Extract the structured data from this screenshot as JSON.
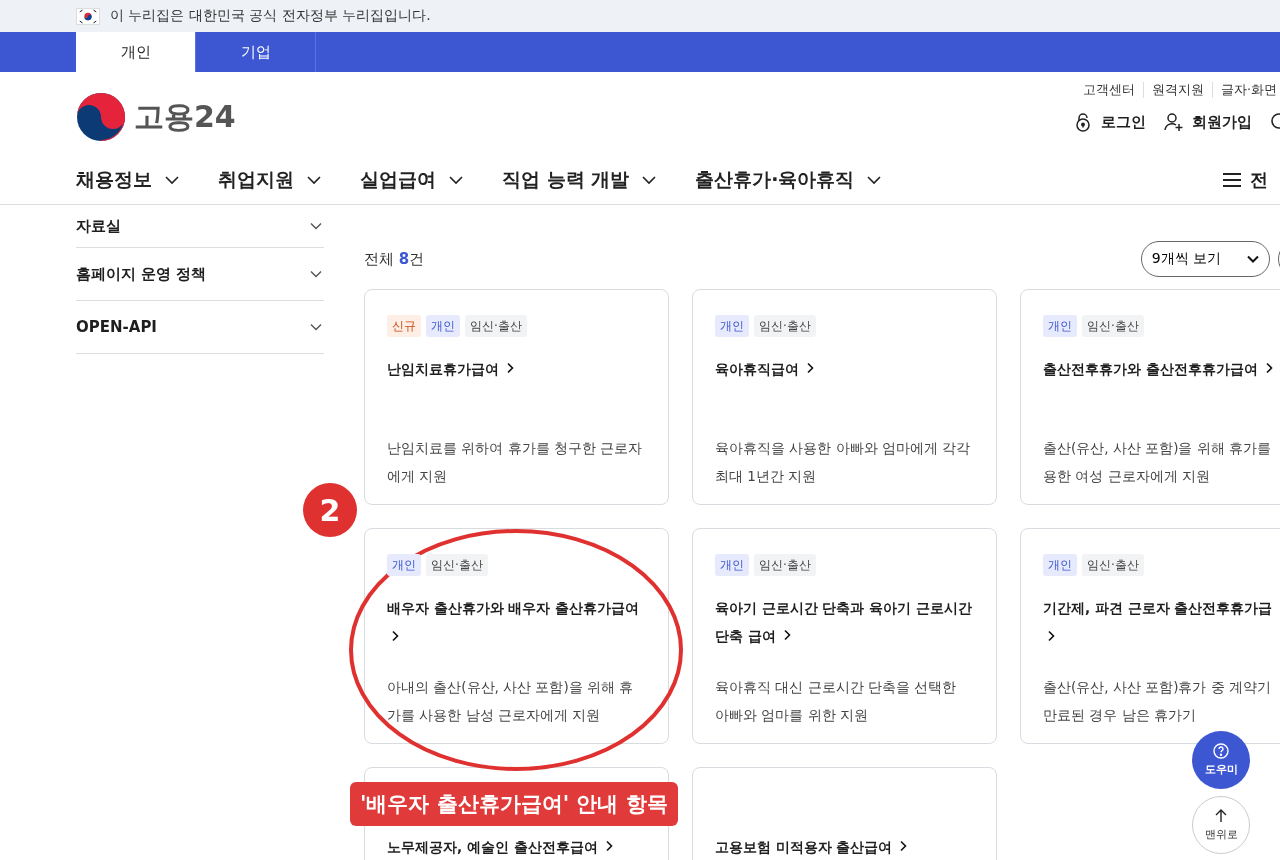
{
  "gov_banner": {
    "text": "이 누리집은 대한민국 공식 전자정부 누리집입니다."
  },
  "user_tabs": [
    {
      "label": "개인",
      "selected": true
    },
    {
      "label": "기업",
      "selected": false
    }
  ],
  "logo": {
    "text": "고용24"
  },
  "util_links": [
    "고객센터",
    "원격지원",
    "글자·화면"
  ],
  "account_links": [
    {
      "kind": "login",
      "label": "로그인"
    },
    {
      "kind": "signup",
      "label": "회원가입"
    }
  ],
  "nav": [
    "채용정보",
    "취업지원",
    "실업급여",
    "직업 능력 개발",
    "출산휴가·육아휴직"
  ],
  "all_menu": "전",
  "sidebar": [
    "자료실",
    "홈페이지 운영 정책",
    "OPEN-API"
  ],
  "result": {
    "prefix": "전체",
    "count": "8",
    "suffix": "건"
  },
  "page_size": "9개씩 보기",
  "cards": [
    {
      "tags": [
        {
          "label": "신규",
          "kind": "new"
        },
        {
          "label": "개인",
          "kind": "target"
        },
        {
          "label": "임신·출산",
          "kind": "category"
        }
      ],
      "title": "난임치료휴가급여",
      "chevron_own_line": false,
      "description": "난임치료를 위하여 휴가를 청구한 근로자\n에게 지원"
    },
    {
      "tags": [
        {
          "label": "개인",
          "kind": "target"
        },
        {
          "label": "임신·출산",
          "kind": "category"
        }
      ],
      "title": "육아휴직급여",
      "chevron_own_line": false,
      "description": "육아휴직을 사용한 아빠와 엄마에게 각각\n최대 1년간 지원"
    },
    {
      "tags": [
        {
          "label": "개인",
          "kind": "target"
        },
        {
          "label": "임신·출산",
          "kind": "category"
        }
      ],
      "title": "출산전후휴가와 출산전후휴가급여",
      "chevron_own_line": false,
      "description": "출산(유산, 사산 포함)을 위해 휴가를\n용한 여성 근로자에게 지원"
    },
    {
      "tags": [
        {
          "label": "개인",
          "kind": "target"
        },
        {
          "label": "임신·출산",
          "kind": "category"
        }
      ],
      "title": "배우자 출산휴가와 배우자 출산휴가급여",
      "chevron_own_line": true,
      "description": "아내의 출산(유산, 사산 포함)을 위해 휴\n가를 사용한 남성 근로자에게 지원"
    },
    {
      "tags": [
        {
          "label": "개인",
          "kind": "target"
        },
        {
          "label": "임신·출산",
          "kind": "category"
        }
      ],
      "title": "육아기 근로시간 단축과 육아기 근로시간\n단축 급여",
      "chevron_own_line": false,
      "description": "육아휴직 대신 근로시간 단축을 선택한\n아빠와 엄마를 위한 지원"
    },
    {
      "tags": [
        {
          "label": "개인",
          "kind": "target"
        },
        {
          "label": "임신·출산",
          "kind": "category"
        }
      ],
      "title": "기간제, 파견 근로자 출산전후휴가급",
      "chevron_own_line": true,
      "description": "출산(유산, 사산 포함)휴가 중 계약기\n만료된 경우 남은 휴가기"
    },
    {
      "title": "노무제공자, 예술인 출산전후급여",
      "chevron_own_line": false
    },
    {
      "title": "고용보험 미적용자 출산급여",
      "chevron_own_line": false
    }
  ],
  "help_button": "도우미",
  "top_button": "맨위로",
  "annotation": {
    "number": "2",
    "label": "'배우자 출산휴가급여' 안내 항목"
  }
}
